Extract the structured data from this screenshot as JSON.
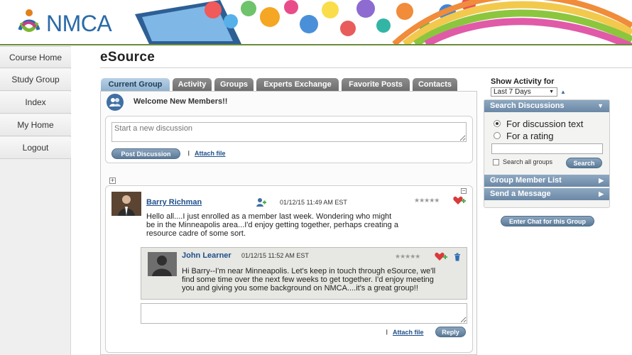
{
  "brand": {
    "name": "NMCA"
  },
  "nav": {
    "items": [
      {
        "label": "Course Home"
      },
      {
        "label": "Study Group"
      },
      {
        "label": "Index"
      },
      {
        "label": "My Home"
      },
      {
        "label": "Logout"
      }
    ]
  },
  "page": {
    "title": "eSource"
  },
  "tabs": [
    {
      "label": "Current Group",
      "active": true
    },
    {
      "label": "Activity"
    },
    {
      "label": "Groups"
    },
    {
      "label": "Experts Exchange"
    },
    {
      "label": "Favorite Posts"
    },
    {
      "label": "Contacts"
    }
  ],
  "welcome": {
    "text": "Welcome New Members!!"
  },
  "compose": {
    "placeholder": "Start a new discussion",
    "post_label": "Post Discussion",
    "attach_label": "Attach file"
  },
  "post": {
    "author": "Barry Richman",
    "timestamp": "01/12/15 11:49 AM EST",
    "rating_stars": "★★★★★",
    "lines": [
      "Hello all....I just enrolled as a member last week.  Wondering who might",
      "be in the Minneapolis area...I'd enjoy getting together, perhaps creating a",
      "resource cadre of some sort."
    ]
  },
  "reply": {
    "author": "John Learner",
    "timestamp": "01/12/15 11:52 AM EST",
    "rating_stars": "★★★★★",
    "lines": [
      "Hi Barry--I'm near Minneapolis.  Let's keep in touch through eSource, we'll",
      "find some time over the next few weeks to get together.  I'd enjoy meeting",
      "you and giving you some background on NMCA....it's a great group!!"
    ],
    "attach_label": "Attach file",
    "reply_label": "Reply"
  },
  "activity": {
    "label": "Show Activity for",
    "selected": "Last 7 Days"
  },
  "search": {
    "header": "Search Discussions",
    "option_text": "For discussion text",
    "option_rating": "For a rating",
    "all_groups_label": "Search all groups",
    "button_label": "Search"
  },
  "members": {
    "header": "Group Member List"
  },
  "message": {
    "header": "Send a Message"
  },
  "chat": {
    "button_label": "Enter Chat for this Group"
  },
  "colors": {
    "accent": "#2a6aa8",
    "tab_active": "#8fb2cf",
    "header_line": "#6b8c3a"
  }
}
